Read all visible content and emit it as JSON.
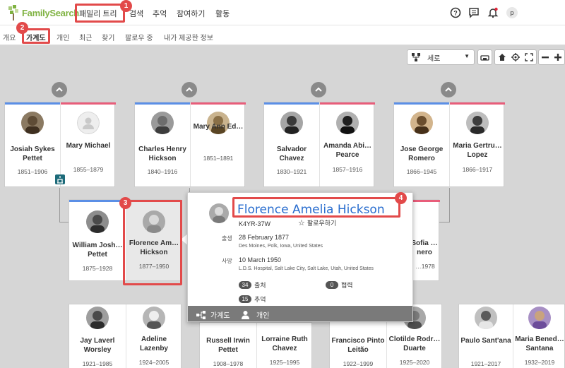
{
  "topnav": {
    "logo_text": "FamilySearch",
    "links": [
      "패밀리 트리",
      "검색",
      "추억",
      "참여하기",
      "활동"
    ],
    "avatar_letter": "p"
  },
  "subnav": {
    "tabs": [
      "개요",
      "가계도",
      "개인",
      "최근",
      "찾기",
      "팔로우 중",
      "내가 제공한 정보"
    ],
    "active_tab": "가계도"
  },
  "badges": [
    "1",
    "2",
    "3",
    "4"
  ],
  "toolbar": {
    "view_select": "세로"
  },
  "colors": {
    "male": "#5b8fe6",
    "female": "#e85d7a",
    "highlight": "#e24a4a",
    "brand": "#7fb241",
    "link": "#2a6ecf"
  },
  "tree": {
    "grandparents": [
      {
        "husband": {
          "name": "Josiah Sykes Pettet",
          "dates": "1851–1906"
        },
        "wife": {
          "name": "Mary Michael",
          "dates": "1855–1879"
        }
      },
      {
        "husband": {
          "name": "Charles Henry Hickson",
          "dates": "1840–1916"
        },
        "wife": {
          "name": "Mary Ann Ed…",
          "dates": "1851–1891"
        }
      },
      {
        "husband": {
          "name": "Salvador Chavez",
          "dates": "1830–1921"
        },
        "wife": {
          "name": "Amanda Abi… Pearce",
          "dates": "1857–1916"
        }
      },
      {
        "husband": {
          "name": "Jose George Romero",
          "dates": "1866–1945"
        },
        "wife": {
          "name": "Maria Gertru… Lopez",
          "dates": "1866–1917"
        }
      }
    ],
    "parents": [
      {
        "husband": {
          "name": "William Josh… Pettet",
          "dates": "1875–1928"
        },
        "wife": {
          "name": "Florence Am… Hickson",
          "dates": "1877–1950"
        }
      },
      {
        "husband": {
          "name": "",
          "dates": ""
        },
        "wife": {
          "name": "Sofia …nero",
          "dates": "…1978"
        }
      }
    ],
    "children_row": [
      {
        "husband": {
          "name": "Jay Laverl Worsley",
          "dates": "1921–1985"
        },
        "wife": {
          "name": "Adeline Lazenby",
          "dates": "1924–2005"
        }
      },
      {
        "husband": {
          "name": "Russell Irwin Pettet",
          "dates": "1908–1978"
        },
        "wife": {
          "name": "Lorraine Ruth Chavez",
          "dates": "1925–1995"
        }
      },
      {
        "husband": {
          "name": "Francisco Pinto Leitão",
          "dates": "1922–1999"
        },
        "wife": {
          "name": "Clotilde Rodr… Duarte",
          "dates": "1925–2020"
        }
      },
      {
        "husband": {
          "name": "Paulo Sant'ana",
          "dates": "1921–2017"
        },
        "wife": {
          "name": "Maria Bened… Santana",
          "dates": "1932–2019"
        }
      }
    ]
  },
  "popup": {
    "name": "Florence Amelia Hickson",
    "pid": "K4YR-37W",
    "follow_label": "팔로우하기",
    "birth_label": "출생",
    "birth_date": "28 February 1877",
    "birth_place": "Des Moines, Polk, Iowa, United States",
    "death_label": "사망",
    "death_date": "10 March 1950",
    "death_place": "L.D.S. Hospital, Salt Lake City, Salt Lake, Utah, United States",
    "sources_count": "34",
    "sources_label": "출처",
    "collab_count": "0",
    "collab_label": "협력",
    "memories_count": "15",
    "memories_label": "추억",
    "footer_tree": "가계도",
    "footer_person": "개인"
  }
}
